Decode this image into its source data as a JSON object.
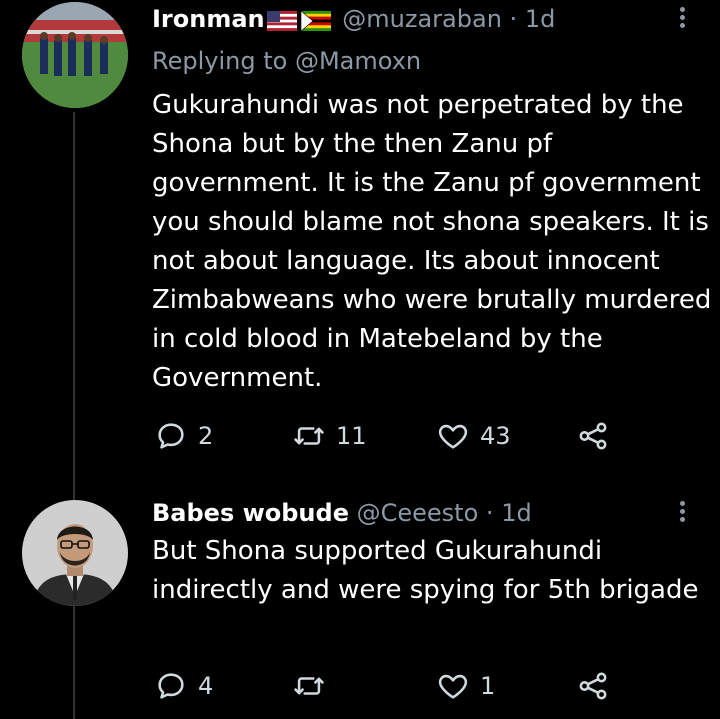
{
  "tweets": [
    {
      "name": "Ironman",
      "flags": [
        "us-flag",
        "zimbabwe-flag"
      ],
      "handle": "@muzaraban",
      "dot": "·",
      "time": "1d",
      "reply_prefix": "Replying to",
      "reply_to": "@Mamoxn",
      "text": "Gukurahundi was not perpetrated by the Shona but by the then Zanu pf government. It is the Zanu pf government you should blame not shona speakers. It is not about language. Its about innocent Zimbabweans who were brutally murdered in cold blood in Matebeland by the Government.",
      "replies": "2",
      "retweets": "11",
      "likes": "43"
    },
    {
      "name": "Babes wobude",
      "handle": "@Ceeesto",
      "dot": "·",
      "time": "1d",
      "text": "But Shona supported Gukurahundi indirectly and were spying for 5th brigade",
      "replies": "4",
      "retweets": "",
      "likes": "1"
    }
  ],
  "colors": {
    "background": "#000000",
    "text": "#ffffff",
    "muted": "#8b98a5"
  }
}
